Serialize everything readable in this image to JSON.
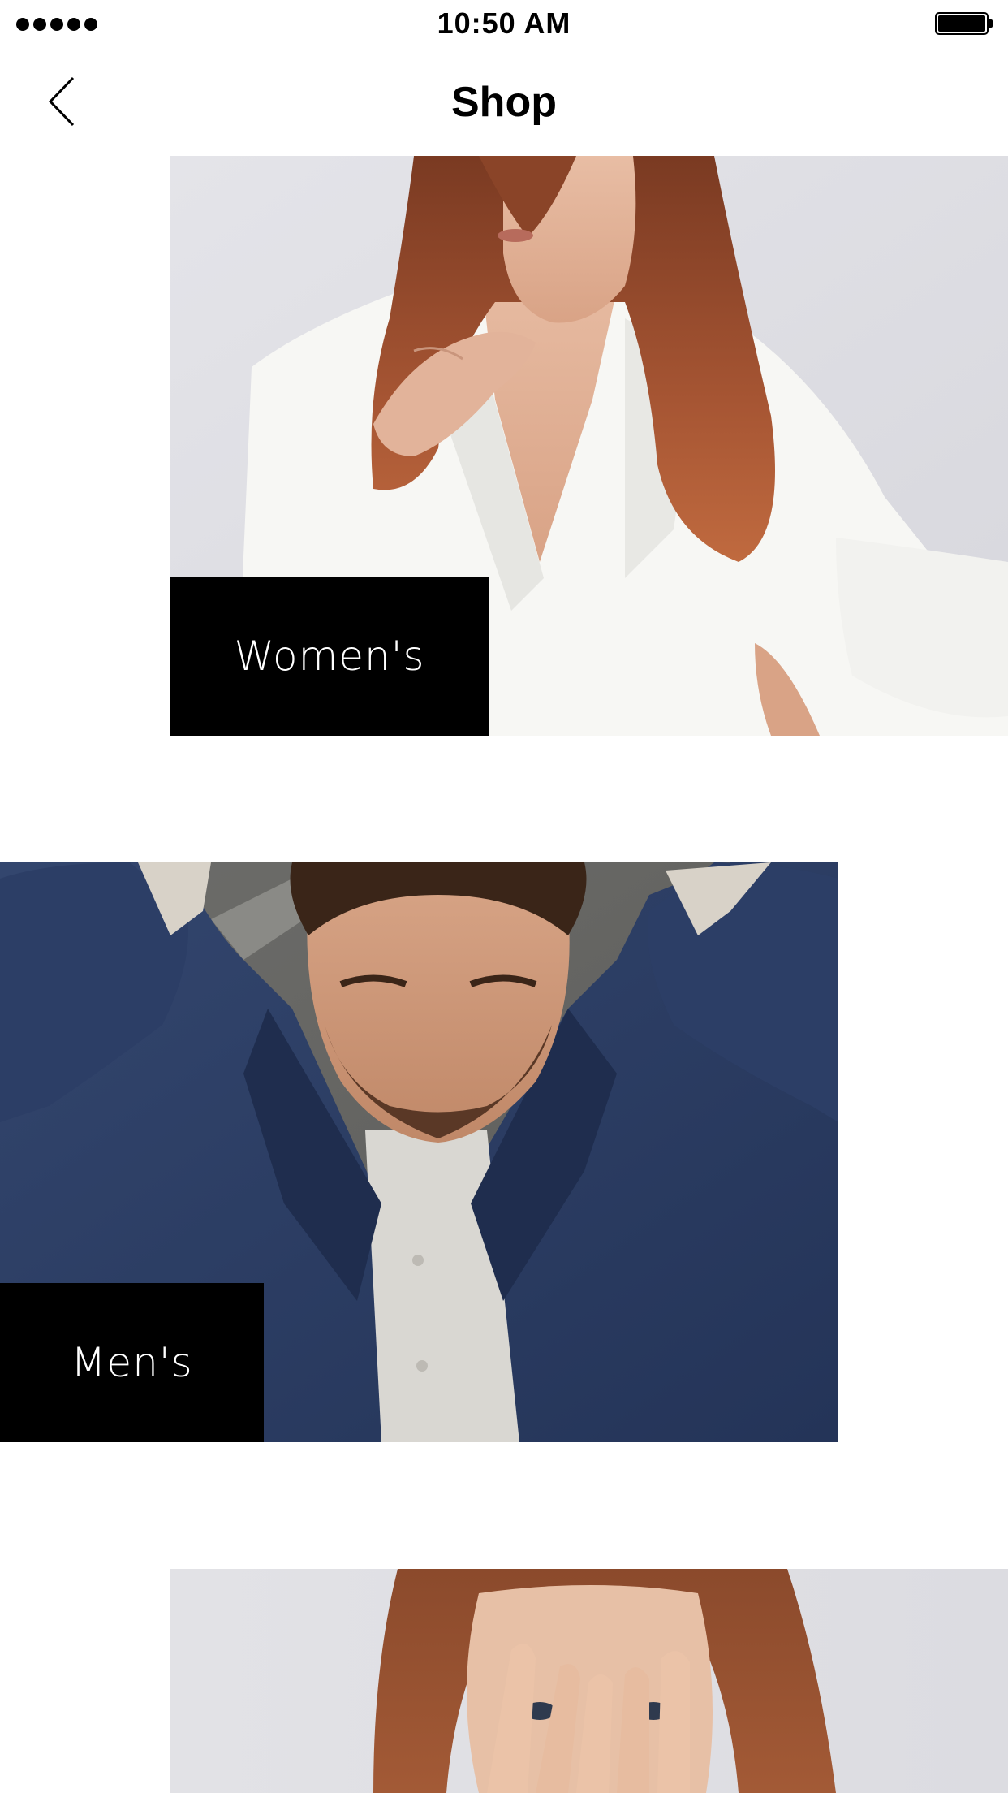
{
  "status_bar": {
    "time": "10:50 AM",
    "signal_icon": "signal-dots-icon",
    "battery_icon": "battery-full-icon"
  },
  "nav": {
    "title": "Shop",
    "back_icon": "chevron-left-icon"
  },
  "categories": [
    {
      "label": "Women's",
      "image": "woman-white-blazer-photo"
    },
    {
      "label": "Men's",
      "image": "man-navy-jacket-photo"
    },
    {
      "label": "",
      "image": "woman-hands-over-face-photo"
    }
  ],
  "colors": {
    "background": "#ffffff",
    "label_background": "#000000",
    "label_text": "#ffffff",
    "text": "#000000"
  }
}
